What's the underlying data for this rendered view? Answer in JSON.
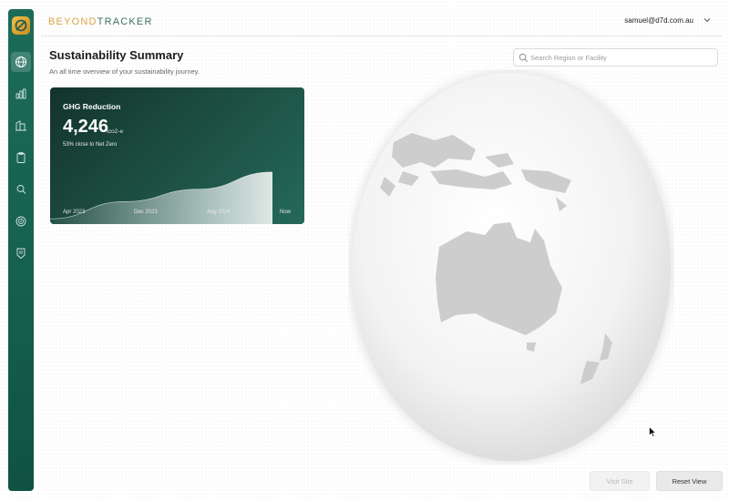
{
  "brand": {
    "part1": "BEYOND",
    "part2": "TRACKER"
  },
  "header": {
    "user_email": "samuel@d7d.com.au"
  },
  "sidebar": {
    "items": [
      {
        "icon": "globe-icon",
        "active": true
      },
      {
        "icon": "bar-chart-icon",
        "active": false
      },
      {
        "icon": "building-icon",
        "active": false
      },
      {
        "icon": "clipboard-icon",
        "active": false
      },
      {
        "icon": "search-doc-icon",
        "active": false
      },
      {
        "icon": "target-icon",
        "active": false
      },
      {
        "icon": "badge-icon",
        "active": false
      }
    ]
  },
  "page": {
    "title": "Sustainability Summary",
    "subtitle": "An all time overview of your sustainability journey."
  },
  "search": {
    "placeholder": "Search Region or Facility",
    "value": ""
  },
  "card": {
    "title": "GHG Reduction",
    "value": "4,246",
    "unit": "tco2-e",
    "note": "53% close to Net Zero",
    "chart_x_labels": [
      "Apr 2023",
      "Dec 2023",
      "Aug 2024",
      "Now"
    ]
  },
  "chart_data": {
    "type": "area",
    "x": [
      "Apr 2023",
      "Dec 2023",
      "Aug 2024",
      "Now"
    ],
    "series": [
      {
        "values": [
          2,
          24,
          40,
          62
        ]
      }
    ],
    "ylim": [
      0,
      70
    ]
  },
  "buttons": {
    "visit_site": "Visit Site",
    "reset_view": "Reset View"
  },
  "colors": {
    "sidebar": "#16604f",
    "brand_gold": "#d9a443",
    "brand_green": "#3f6f5e",
    "card_start": "#13332b",
    "card_end": "#24695a",
    "land": "#cfcfcf"
  }
}
